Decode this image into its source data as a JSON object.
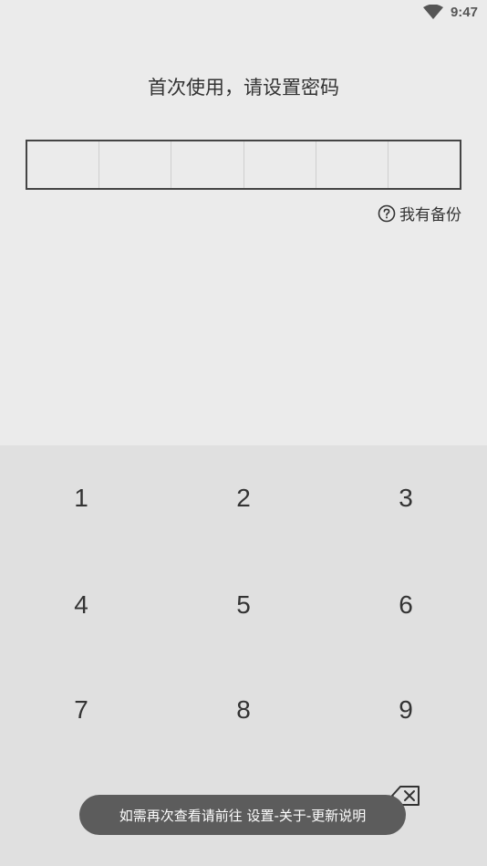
{
  "status_bar": {
    "time": "9:47",
    "wifi_icon": "wifi-icon"
  },
  "title": "首次使用，请设置密码",
  "pin": {
    "length": 6
  },
  "backup_link": {
    "label": "我有备份",
    "icon": "help-circle-icon"
  },
  "keypad": {
    "keys": [
      "1",
      "2",
      "3",
      "4",
      "5",
      "6",
      "7",
      "8",
      "9"
    ],
    "backspace_icon": "backspace-icon"
  },
  "toast": {
    "message": "如需再次查看请前往 设置-关于-更新说明"
  },
  "colors": {
    "background": "#ebebeb",
    "keypad_background": "#e0e0e0",
    "toast_background": "#5c5c5c",
    "text": "#333333"
  }
}
